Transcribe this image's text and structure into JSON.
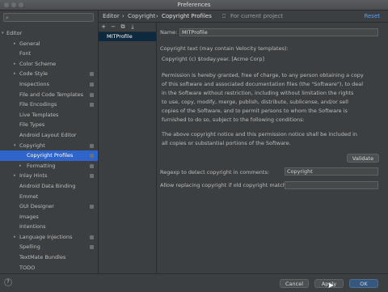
{
  "window": {
    "title": "Preferences"
  },
  "search": {
    "placeholder": "",
    "icon": "search-icon"
  },
  "sidebar": {
    "items": [
      {
        "label": "Editor",
        "level": 0,
        "arrow": "▾",
        "project": false
      },
      {
        "label": "General",
        "level": 1,
        "arrow": "▸",
        "project": false
      },
      {
        "label": "Font",
        "level": 1,
        "arrow": "",
        "project": false
      },
      {
        "label": "Color Scheme",
        "level": 1,
        "arrow": "▸",
        "project": false
      },
      {
        "label": "Code Style",
        "level": 1,
        "arrow": "▸",
        "project": true
      },
      {
        "label": "Inspections",
        "level": 1,
        "arrow": "",
        "project": true
      },
      {
        "label": "File and Code Templates",
        "level": 1,
        "arrow": "",
        "project": true
      },
      {
        "label": "File Encodings",
        "level": 1,
        "arrow": "",
        "project": true
      },
      {
        "label": "Live Templates",
        "level": 1,
        "arrow": "",
        "project": false
      },
      {
        "label": "File Types",
        "level": 1,
        "arrow": "",
        "project": false
      },
      {
        "label": "Android Layout Editor",
        "level": 1,
        "arrow": "",
        "project": false
      },
      {
        "label": "Copyright",
        "level": 1,
        "arrow": "▾",
        "project": true
      },
      {
        "label": "Copyright Profiles",
        "level": 2,
        "arrow": "",
        "project": true,
        "selected": true
      },
      {
        "label": "Formatting",
        "level": 2,
        "arrow": "▸",
        "project": true
      },
      {
        "label": "Inlay Hints",
        "level": 1,
        "arrow": "▸",
        "project": true
      },
      {
        "label": "Android Data Binding",
        "level": 1,
        "arrow": "",
        "project": false
      },
      {
        "label": "Emmet",
        "level": 1,
        "arrow": "",
        "project": false
      },
      {
        "label": "GUI Designer",
        "level": 1,
        "arrow": "",
        "project": true
      },
      {
        "label": "Images",
        "level": 1,
        "arrow": "",
        "project": false
      },
      {
        "label": "Intentions",
        "level": 1,
        "arrow": "",
        "project": false
      },
      {
        "label": "Language Injections",
        "level": 1,
        "arrow": "▸",
        "project": true
      },
      {
        "label": "Spelling",
        "level": 1,
        "arrow": "",
        "project": true
      },
      {
        "label": "TextMate Bundles",
        "level": 1,
        "arrow": "",
        "project": false
      },
      {
        "label": "TODO",
        "level": 1,
        "arrow": "",
        "project": false
      }
    ]
  },
  "header": {
    "breadcrumb": [
      "Editor",
      "›",
      "Copyright",
      "›",
      "Copyright Profiles"
    ],
    "scope_note": "For current project",
    "reset": "Reset"
  },
  "profiles": {
    "toolbar": [
      "+",
      "−",
      "⧉",
      "⤓"
    ],
    "items": [
      "MITProfile"
    ]
  },
  "form": {
    "name_label": "Name:",
    "name_value": "MITProfile",
    "text_label": "Copyright text (may contain Velocity templates):",
    "copyright_line": "Copyright (c) $today.year. [Acme Corp]",
    "permission_lines": [
      "Permission is hereby granted, free of charge, to any person obtaining a copy",
      "of this software and associated documentation files (the \"Software\"), to deal",
      "in the Software without restriction, including without limitation the rights",
      "to use, copy, modify, merge, publish, distribute, sublicense, and/or sell",
      "copies of the Software, and to permit persons to whom the Software is",
      "furnished to do so, subject to the following conditions:"
    ],
    "notice_lines": [
      "The above copyright notice and this permission notice shall be included in",
      "all copies or substantial portions of the Software."
    ],
    "validate": "Validate",
    "regexp_label": "Regexp to detect copyright in comments:",
    "regexp_value": "Copyright",
    "replace_label": "Allow replacing copyright if old copyright matches:",
    "replace_value": ""
  },
  "footer": {
    "help": "?",
    "cancel": "Cancel",
    "apply": "Apply",
    "ok": "OK"
  },
  "colors": {
    "accent": "#2f65ca",
    "link": "#589df6",
    "panel": "#3c3f41",
    "primary_button": "#365880"
  }
}
